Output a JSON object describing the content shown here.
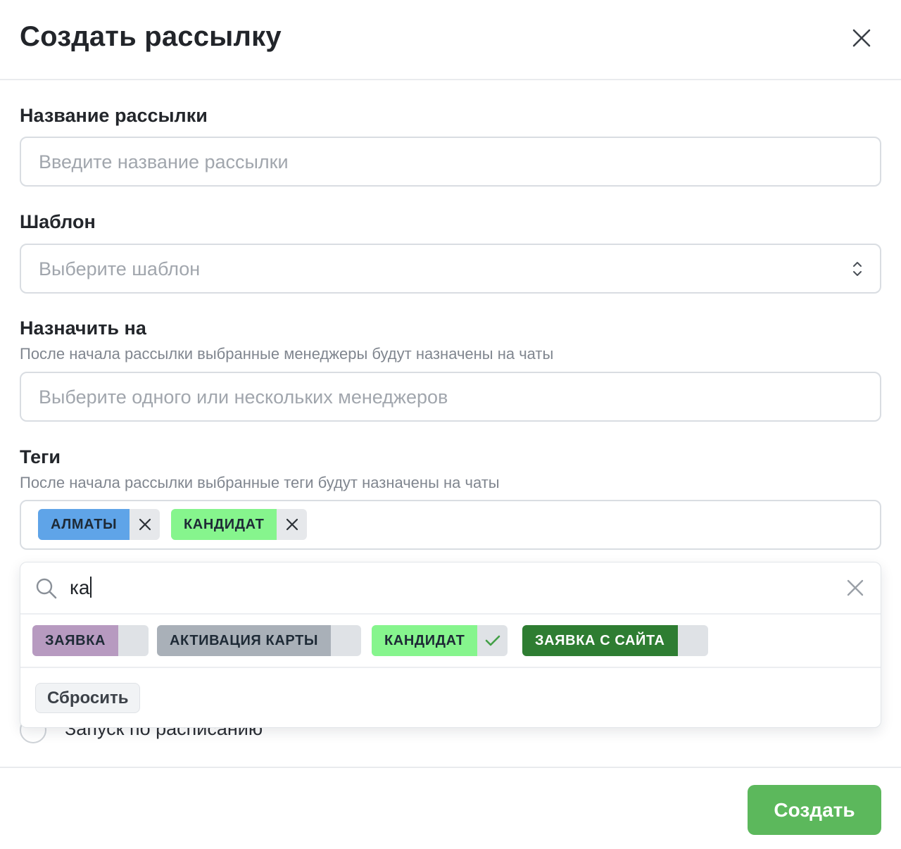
{
  "dialog": {
    "title": "Создать рассылку"
  },
  "name_field": {
    "label": "Название рассылки",
    "placeholder": "Введите название рассылки",
    "value": ""
  },
  "template_field": {
    "label": "Шаблон",
    "placeholder": "Выберите шаблон",
    "icon": "chevron-up-down-icon"
  },
  "assign_field": {
    "label": "Назначить на",
    "hint": "После начала рассылки выбранные менеджеры будут назначены на чаты",
    "placeholder": "Выберите одного или нескольких менеджеров"
  },
  "tags_field": {
    "label": "Теги",
    "hint": "После начала рассылки выбранные теги будут назначены на чаты",
    "selected": [
      {
        "label": "АЛМАТЫ",
        "color": "#5fa4e8"
      },
      {
        "label": "КАНДИДАТ",
        "color": "#86f58d"
      }
    ]
  },
  "tag_dropdown": {
    "search_value": "ка",
    "options": [
      {
        "label": "ЗАЯВКА",
        "color": "#b79ac0",
        "text_color": "#1e2a36",
        "checked": false
      },
      {
        "label": "АКТИВАЦИЯ КАРТЫ",
        "color": "#a9b0b8",
        "text_color": "#1e2a36",
        "checked": false
      },
      {
        "label": "КАНДИДАТ",
        "color": "#86f58d",
        "text_color": "#1e2a36",
        "checked": true
      },
      {
        "label": "ЗАЯВКА С САЙТА",
        "color": "#2e7d32",
        "text_color": "#ffffff",
        "checked": false
      }
    ],
    "reset_label": "Сбросить"
  },
  "schedule": {
    "label": "Запуск по расписанию",
    "checked": false
  },
  "footer": {
    "submit_label": "Создать",
    "submit_color": "#5cb85c"
  }
}
